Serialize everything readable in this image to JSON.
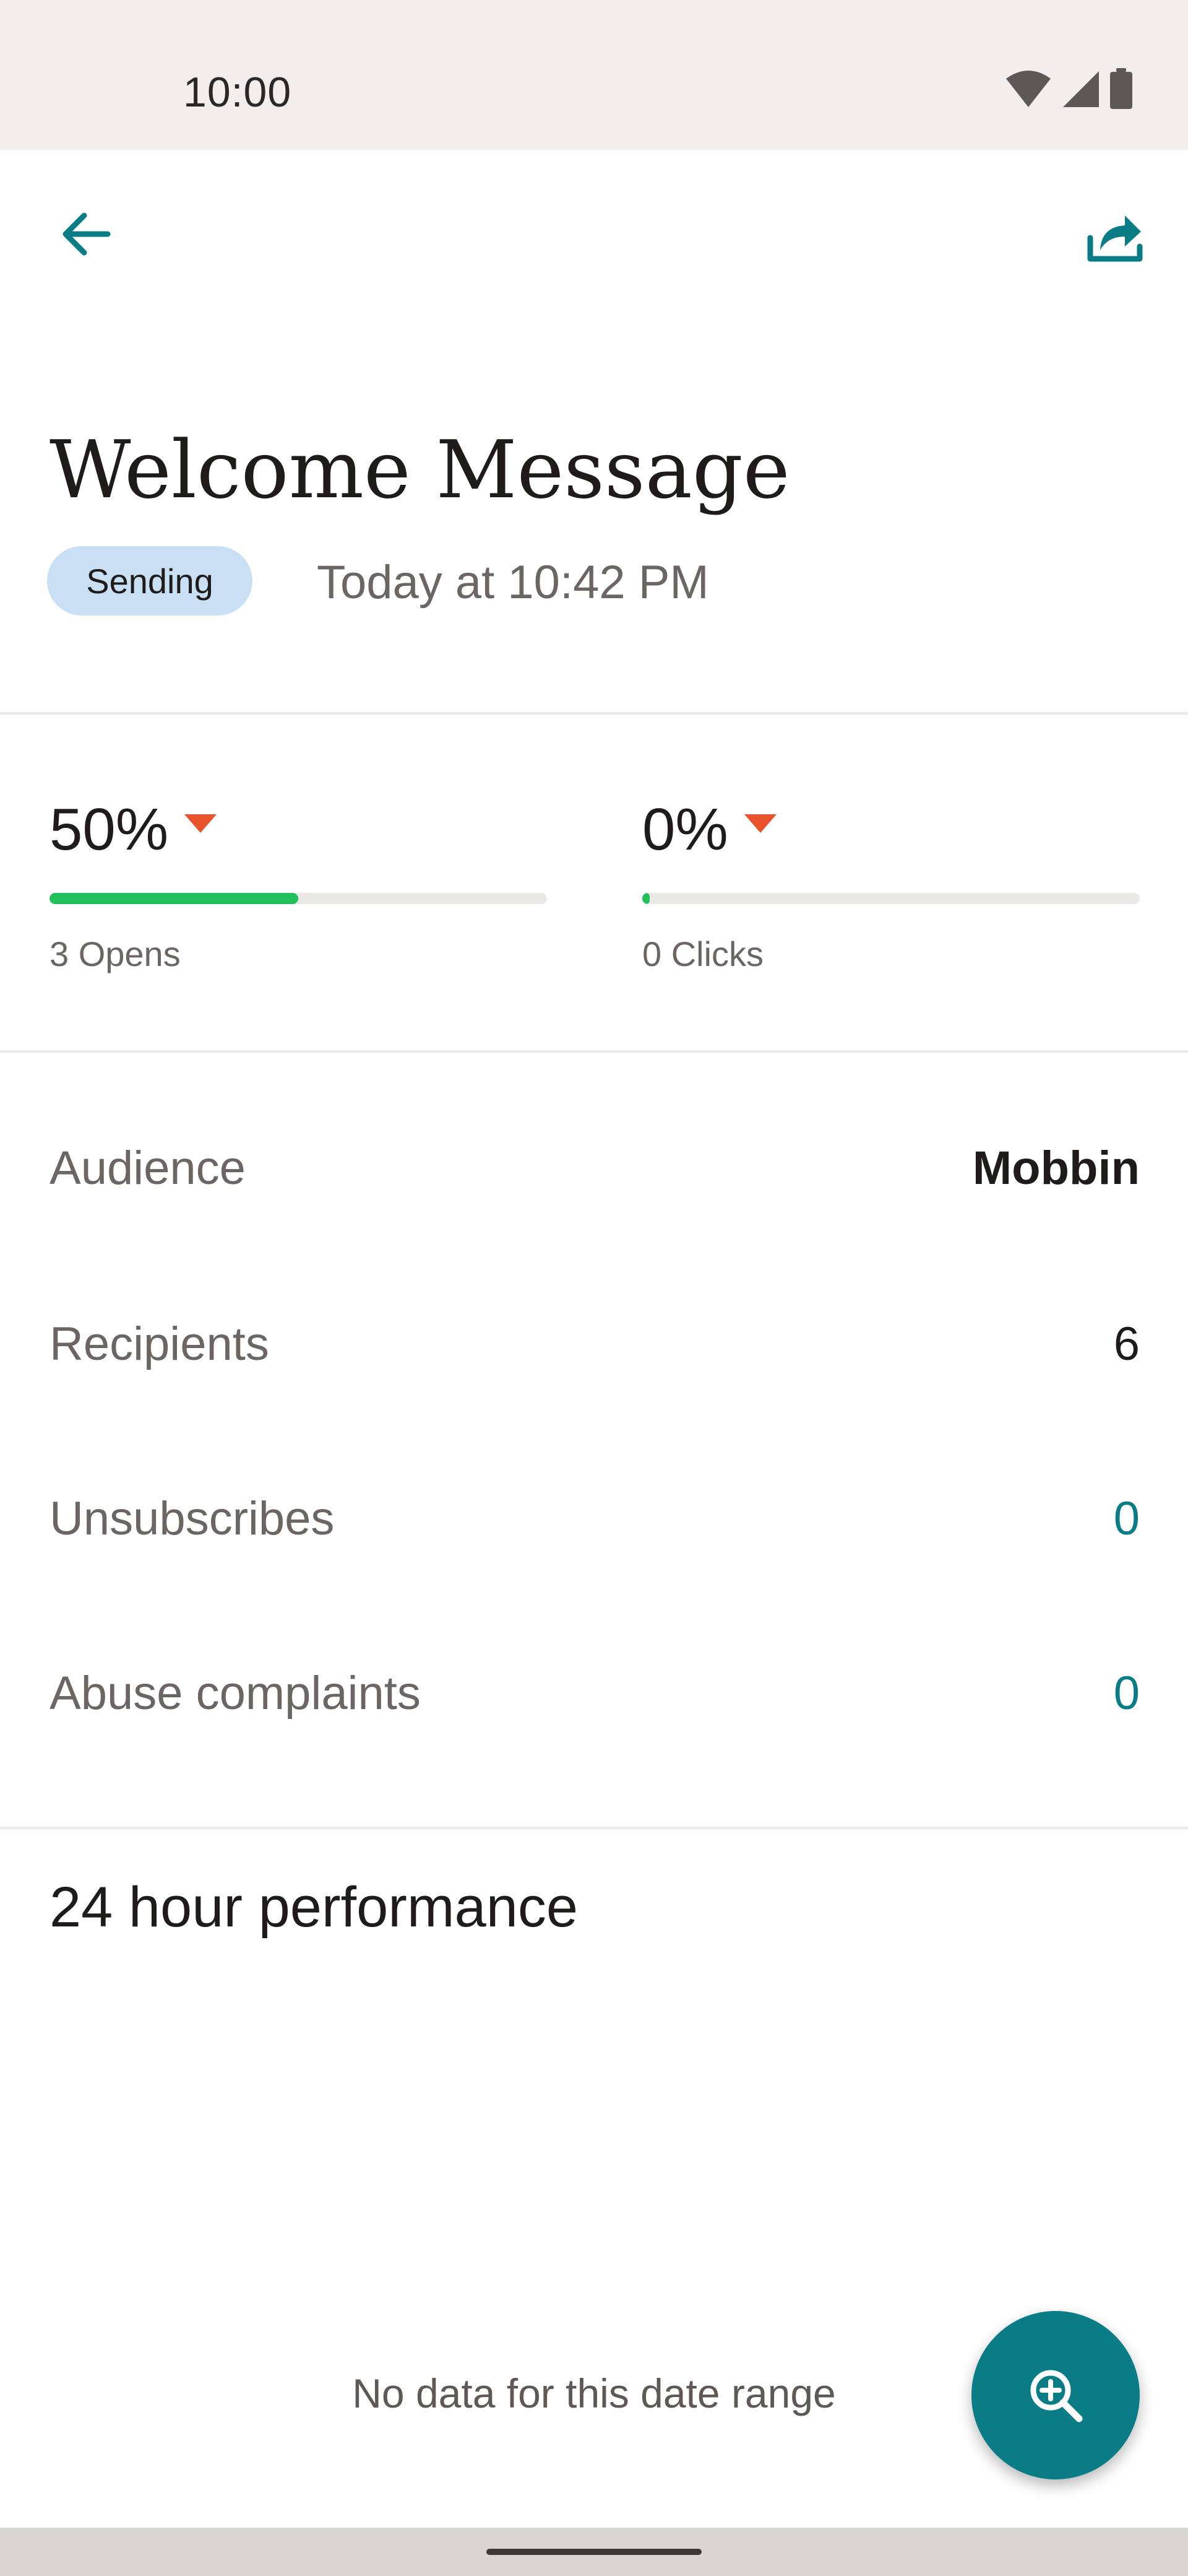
{
  "status_bar": {
    "time": "10:00",
    "icons": [
      "wifi-icon",
      "cellular-signal-icon",
      "battery-icon"
    ]
  },
  "app_bar": {
    "back_icon": "arrow-left-icon",
    "share_icon": "share-icon",
    "accent_color": "#0a7c86"
  },
  "campaign": {
    "title": "Welcome Message",
    "status_badge": "Sending",
    "badge_color": "#c9dff3",
    "timestamp": "Today at 10:42 PM"
  },
  "stats": {
    "opens": {
      "value": "50%",
      "label": "3 Opens",
      "progress_percent": 50,
      "trend": "down",
      "trend_icon": "triangle-down-icon"
    },
    "clicks": {
      "value": "0%",
      "label": "0 Clicks",
      "progress_percent": 0,
      "trend": "down",
      "trend_icon": "triangle-down-icon"
    },
    "progress_color": "#1fbf5b",
    "trend_color": "#e8532b"
  },
  "details": {
    "audience_label": "Audience",
    "audience_value": "Mobbin",
    "recipients_label": "Recipients",
    "recipients_value": "6",
    "unsubscribes_label": "Unsubscribes",
    "unsubscribes_value": "0",
    "abuse_label": "Abuse complaints",
    "abuse_value": "0"
  },
  "performance": {
    "title": "24 hour performance",
    "empty_message": "No data for this date range"
  },
  "fab": {
    "icon": "zoom-in-icon"
  }
}
